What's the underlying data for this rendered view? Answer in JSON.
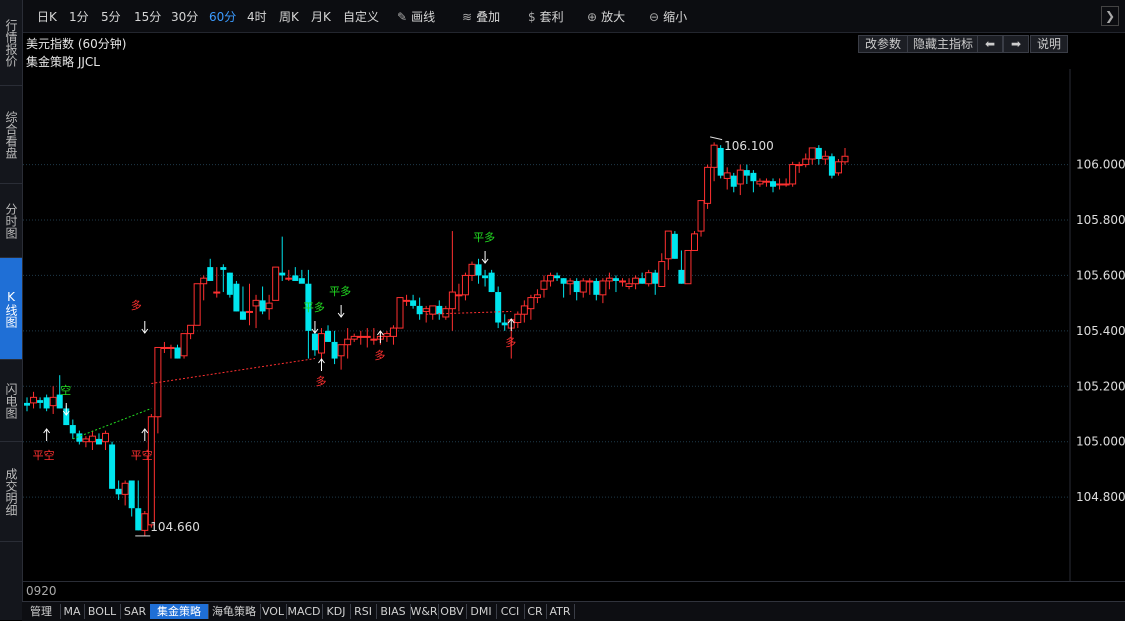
{
  "left_tabs": [
    "行情报价",
    "综合看盘",
    "分时图",
    "K线图",
    "闪电图",
    "成交明细"
  ],
  "left_active": 3,
  "periods": [
    "日K",
    "1分",
    "5分",
    "15分",
    "30分",
    "60分",
    "4时",
    "周K",
    "月K",
    "自定义"
  ],
  "period_active": "60分",
  "tools": [
    {
      "icon": "pencil-icon",
      "label": "画线"
    },
    {
      "icon": "stack-icon",
      "label": "叠加"
    },
    {
      "icon": "money-bag-icon",
      "label": "套利"
    },
    {
      "icon": "zoom-in-icon",
      "label": "放大"
    },
    {
      "icon": "zoom-out-icon",
      "label": "缩小"
    }
  ],
  "chart_title": "美元指数 (60分钟)",
  "strategy_label": "集金策略 JJCL",
  "header_buttons": [
    "改参数",
    "隐藏主指标",
    "⬅",
    "➡",
    "说明"
  ],
  "bottom_left_label": "0920",
  "bottom_tabs": [
    "管理",
    "MA",
    "BOLL",
    "SAR",
    "集金策略",
    "海龟策略",
    "VOL",
    "MACD",
    "KDJ",
    "RSI",
    "BIAS",
    "W&R",
    "OBV",
    "DMI",
    "CCI",
    "CR",
    "ATR"
  ],
  "bottom_active": "集金策略",
  "colors": {
    "up": "#ff3030",
    "down": "#00e5ee",
    "grid": "#1f3a4a",
    "buy_signal": "#ff3030",
    "sell_signal": "#22dd22",
    "accent": "#1f6fd6"
  },
  "chart_data": {
    "type": "candlestick",
    "y_ticks": [
      "106.000",
      "105.800",
      "105.600",
      "105.400",
      "105.200",
      "105.000",
      "104.800"
    ],
    "ylim": [
      104.62,
      106.15
    ],
    "high_label": "106.100",
    "low_label": "104.660",
    "signals": [
      "平空",
      "空",
      "多",
      "平空",
      "多",
      "平多",
      "平多",
      "多",
      "平多",
      "多"
    ],
    "candles": [
      [
        105.14,
        105.16,
        105.11,
        105.13
      ],
      [
        105.14,
        105.18,
        105.12,
        105.16
      ],
      [
        105.15,
        105.16,
        105.12,
        105.14
      ],
      [
        105.16,
        105.17,
        105.11,
        105.12
      ],
      [
        105.13,
        105.2,
        105.1,
        105.16
      ],
      [
        105.17,
        105.24,
        105.12,
        105.12
      ],
      [
        105.12,
        105.13,
        105.06,
        105.06
      ],
      [
        105.06,
        105.08,
        105.01,
        105.03
      ],
      [
        105.03,
        105.04,
        104.99,
        105.0
      ],
      [
        105.0,
        105.02,
        104.98,
        105.01
      ],
      [
        105.0,
        105.04,
        104.97,
        105.02
      ],
      [
        105.01,
        105.03,
        104.99,
        104.99
      ],
      [
        105.0,
        105.04,
        104.97,
        105.03
      ],
      [
        104.99,
        105.0,
        104.83,
        104.83
      ],
      [
        104.83,
        104.86,
        104.79,
        104.81
      ],
      [
        104.81,
        104.86,
        104.77,
        104.85
      ],
      [
        104.86,
        104.86,
        104.73,
        104.76
      ],
      [
        104.76,
        104.86,
        104.68,
        104.68
      ],
      [
        104.68,
        104.75,
        104.66,
        104.74
      ],
      [
        104.7,
        105.1,
        104.69,
        105.09
      ],
      [
        105.09,
        105.2,
        105.03,
        105.34
      ],
      [
        105.34,
        105.36,
        105.32,
        105.34
      ],
      [
        105.34,
        105.35,
        105.3,
        105.34
      ],
      [
        105.34,
        105.35,
        105.3,
        105.3
      ],
      [
        105.31,
        105.38,
        105.3,
        105.39
      ],
      [
        105.39,
        105.42,
        105.37,
        105.42
      ],
      [
        105.42,
        105.57,
        105.42,
        105.57
      ],
      [
        105.57,
        105.6,
        105.51,
        105.59
      ],
      [
        105.63,
        105.66,
        105.58,
        105.58
      ],
      [
        105.54,
        105.63,
        105.52,
        105.54
      ],
      [
        105.63,
        105.64,
        105.54,
        105.62
      ],
      [
        105.61,
        105.61,
        105.52,
        105.53
      ],
      [
        105.57,
        105.58,
        105.47,
        105.47
      ],
      [
        105.47,
        105.56,
        105.44,
        105.44
      ],
      [
        105.47,
        105.57,
        105.42,
        105.47
      ],
      [
        105.49,
        105.53,
        105.41,
        105.51
      ],
      [
        105.51,
        105.56,
        105.46,
        105.47
      ],
      [
        105.48,
        105.53,
        105.44,
        105.5
      ],
      [
        105.51,
        105.63,
        105.51,
        105.63
      ],
      [
        105.61,
        105.74,
        105.58,
        105.6
      ],
      [
        105.59,
        105.62,
        105.58,
        105.59
      ],
      [
        105.6,
        105.63,
        105.59,
        105.58
      ],
      [
        105.59,
        105.62,
        105.58,
        105.57
      ],
      [
        105.57,
        105.62,
        105.3,
        105.4
      ],
      [
        105.39,
        105.41,
        105.31,
        105.33
      ],
      [
        105.32,
        105.41,
        105.3,
        105.39
      ],
      [
        105.4,
        105.42,
        105.36,
        105.36
      ],
      [
        105.36,
        105.4,
        105.28,
        105.3
      ],
      [
        105.31,
        105.35,
        105.26,
        105.35
      ],
      [
        105.35,
        105.41,
        105.3,
        105.37
      ],
      [
        105.37,
        105.39,
        105.36,
        105.38
      ],
      [
        105.38,
        105.4,
        105.35,
        105.38
      ],
      [
        105.38,
        105.41,
        105.34,
        105.38
      ],
      [
        105.37,
        105.41,
        105.35,
        105.37
      ],
      [
        105.37,
        105.4,
        105.35,
        105.38
      ],
      [
        105.38,
        105.4,
        105.36,
        105.39
      ],
      [
        105.38,
        105.42,
        105.35,
        105.41
      ],
      [
        105.41,
        105.52,
        105.41,
        105.52
      ],
      [
        105.51,
        105.53,
        105.49,
        105.51
      ],
      [
        105.51,
        105.53,
        105.48,
        105.49
      ],
      [
        105.49,
        105.52,
        105.44,
        105.46
      ],
      [
        105.47,
        105.49,
        105.43,
        105.48
      ],
      [
        105.46,
        105.49,
        105.44,
        105.49
      ],
      [
        105.49,
        105.51,
        105.44,
        105.46
      ],
      [
        105.45,
        105.49,
        105.44,
        105.48
      ],
      [
        105.48,
        105.76,
        105.4,
        105.54
      ],
      [
        105.53,
        105.57,
        105.47,
        105.53
      ],
      [
        105.53,
        105.61,
        105.51,
        105.6
      ],
      [
        105.6,
        105.65,
        105.58,
        105.64
      ],
      [
        105.64,
        105.66,
        105.57,
        105.6
      ],
      [
        105.6,
        105.62,
        105.56,
        105.59
      ],
      [
        105.61,
        105.62,
        105.54,
        105.54
      ],
      [
        105.54,
        105.56,
        105.41,
        105.43
      ],
      [
        105.43,
        105.46,
        105.4,
        105.42
      ],
      [
        105.41,
        105.44,
        105.3,
        105.44
      ],
      [
        105.43,
        105.47,
        105.41,
        105.46
      ],
      [
        105.46,
        105.51,
        105.43,
        105.49
      ],
      [
        105.48,
        105.53,
        105.44,
        105.52
      ],
      [
        105.52,
        105.55,
        105.5,
        105.53
      ],
      [
        105.55,
        105.6,
        105.52,
        105.58
      ],
      [
        105.58,
        105.61,
        105.56,
        105.6
      ],
      [
        105.6,
        105.61,
        105.58,
        105.59
      ],
      [
        105.59,
        105.59,
        105.52,
        105.57
      ],
      [
        105.57,
        105.59,
        105.53,
        105.58
      ],
      [
        105.58,
        105.59,
        105.51,
        105.54
      ],
      [
        105.54,
        105.59,
        105.52,
        105.58
      ],
      [
        105.58,
        105.59,
        105.53,
        105.58
      ],
      [
        105.58,
        105.59,
        105.51,
        105.53
      ],
      [
        105.53,
        105.59,
        105.5,
        105.58
      ],
      [
        105.58,
        105.61,
        105.55,
        105.59
      ],
      [
        105.59,
        105.6,
        105.54,
        105.58
      ],
      [
        105.58,
        105.59,
        105.56,
        105.58
      ],
      [
        105.56,
        105.59,
        105.55,
        105.57
      ],
      [
        105.57,
        105.6,
        105.55,
        105.59
      ],
      [
        105.59,
        105.61,
        105.57,
        105.57
      ],
      [
        105.57,
        105.62,
        105.56,
        105.61
      ],
      [
        105.61,
        105.62,
        105.53,
        105.57
      ],
      [
        105.56,
        105.68,
        105.56,
        105.65
      ],
      [
        105.66,
        105.75,
        105.62,
        105.76
      ],
      [
        105.75,
        105.76,
        105.66,
        105.66
      ],
      [
        105.62,
        105.69,
        105.57,
        105.57
      ],
      [
        105.57,
        105.69,
        105.57,
        105.69
      ],
      [
        105.69,
        105.76,
        105.69,
        105.75
      ],
      [
        105.76,
        105.87,
        105.74,
        105.87
      ],
      [
        105.86,
        106.0,
        105.84,
        105.99
      ],
      [
        105.99,
        106.08,
        105.94,
        106.07
      ],
      [
        106.06,
        106.07,
        105.95,
        105.96
      ],
      [
        105.95,
        105.99,
        105.91,
        105.97
      ],
      [
        105.96,
        105.97,
        105.9,
        105.92
      ],
      [
        105.93,
        106.0,
        105.89,
        105.98
      ],
      [
        105.98,
        106.0,
        105.93,
        105.96
      ],
      [
        105.97,
        105.98,
        105.9,
        105.94
      ],
      [
        105.93,
        105.95,
        105.92,
        105.94
      ],
      [
        105.94,
        105.95,
        105.92,
        105.94
      ],
      [
        105.94,
        105.95,
        105.9,
        105.92
      ],
      [
        105.93,
        105.95,
        105.91,
        105.93
      ],
      [
        105.93,
        105.95,
        105.92,
        105.93
      ],
      [
        105.93,
        106.01,
        105.92,
        106.0
      ],
      [
        106.0,
        106.01,
        105.97,
        106.0
      ],
      [
        106.0,
        106.04,
        105.99,
        106.02
      ],
      [
        106.02,
        106.06,
        106.0,
        106.06
      ],
      [
        106.06,
        106.07,
        106.0,
        106.02
      ],
      [
        106.02,
        106.05,
        106.0,
        106.03
      ],
      [
        106.03,
        106.04,
        105.95,
        105.96
      ],
      [
        105.97,
        106.02,
        105.96,
        106.01
      ],
      [
        106.01,
        106.06,
        106.0,
        106.03
      ]
    ]
  }
}
